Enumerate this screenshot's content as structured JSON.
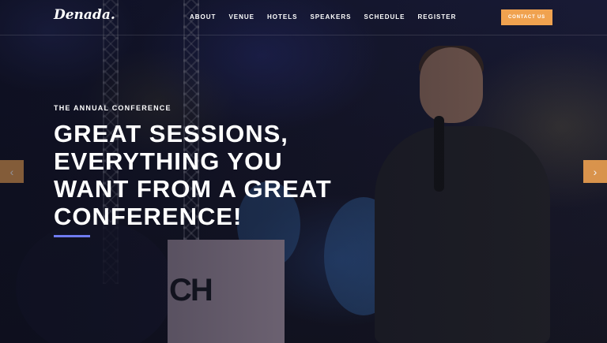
{
  "brand": {
    "logo_text": "Denada."
  },
  "nav": {
    "items": [
      {
        "label": "ABOUT"
      },
      {
        "label": "VENUE"
      },
      {
        "label": "HOTELS"
      },
      {
        "label": "SPEAKERS"
      },
      {
        "label": "SCHEDULE"
      },
      {
        "label": "REGISTER"
      }
    ],
    "cta_label": "CONTACT US"
  },
  "hero": {
    "eyebrow": "THE ANNUAL CONFERENCE",
    "headline_lines": [
      "GREAT SESSIONS,",
      "EVERYTHING YOU",
      "WANT FROM A GREAT",
      "CONFERENCE!"
    ],
    "background_sign_text": "CH"
  },
  "slider": {
    "prev_icon": "chevron-left-icon",
    "next_icon": "chevron-right-icon",
    "prev_glyph": "‹",
    "next_glyph": "›"
  },
  "colors": {
    "accent_orange": "#f0a24f",
    "underline_blue": "#6f7bf0",
    "text_white": "#ffffff"
  }
}
